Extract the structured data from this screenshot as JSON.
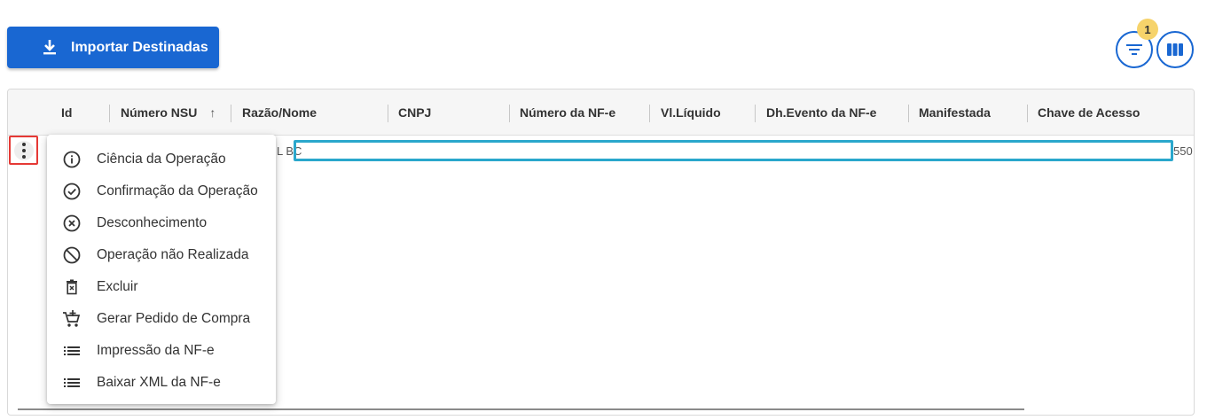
{
  "toolbar": {
    "import_label": "Importar Destinadas",
    "filter_badge_count": "1"
  },
  "grid": {
    "columns": [
      {
        "label": "Id"
      },
      {
        "label": "Número NSU",
        "sort_indicator": "↑"
      },
      {
        "label": "Razão/Nome"
      },
      {
        "label": "CNPJ"
      },
      {
        "label": "Número da NF-e"
      },
      {
        "label": "Vl.Líquido"
      },
      {
        "label": "Dh.Evento da NF-e"
      },
      {
        "label": "Manifestada"
      },
      {
        "label": "Chave de Acesso"
      }
    ],
    "row_fragment_left": "L BC",
    "row_fragment_right": "550"
  },
  "context_menu": {
    "items": [
      {
        "label": "Ciência da Operação",
        "icon": "info-icon"
      },
      {
        "label": "Confirmação da Operação",
        "icon": "check-circle-icon"
      },
      {
        "label": "Desconhecimento",
        "icon": "x-circle-icon"
      },
      {
        "label": "Operação não Realizada",
        "icon": "block-icon"
      },
      {
        "label": "Excluir",
        "icon": "trash-icon"
      },
      {
        "label": "Gerar Pedido de Compra",
        "icon": "cart-add-icon"
      },
      {
        "label": "Impressão da NF-e",
        "icon": "list-icon"
      },
      {
        "label": "Baixar XML da NF-e",
        "icon": "list-icon"
      }
    ]
  },
  "colors": {
    "primary": "#1967d2",
    "badge": "#f6d36b",
    "focus_outline": "#2aa7cc",
    "highlight_border": "#e53935"
  }
}
